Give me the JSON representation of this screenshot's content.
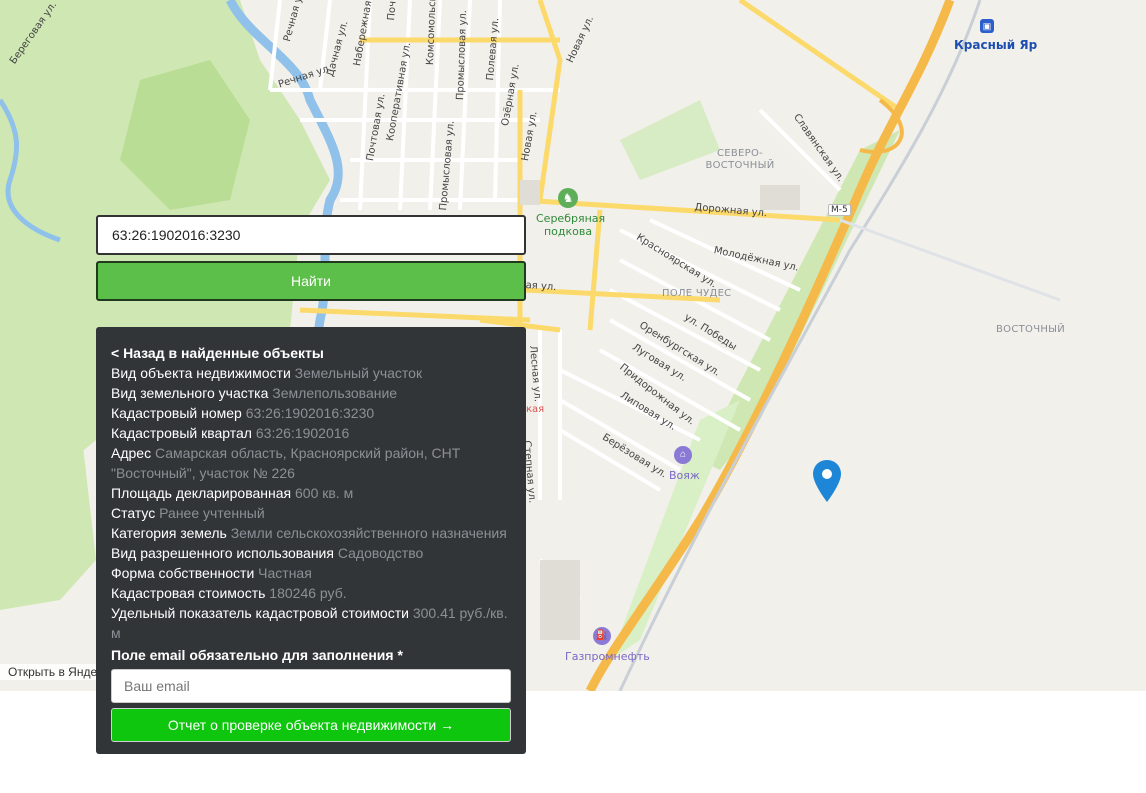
{
  "map": {
    "open_in_yandex": "Открыть в Янде",
    "street_labels": [
      "Береговая ул.",
      "Речная ул.",
      "Речная ул.",
      "Дачная ул.",
      "Набережная ул.",
      "Почтовая ул.",
      "Кооперативная ул.",
      "Комсомольская",
      "Промысловая ул.",
      "Промысловая ул.",
      "Полевая ул.",
      "Озёрная ул.",
      "Новая ул.",
      "Новая ул.",
      "Славянская ул.",
      "Дорожная ул.",
      "Красноярская ул.",
      "Молодёжная ул.",
      "ул. Победы",
      "Оренбургская ул.",
      "Луговая ул.",
      "Придорожная ул.",
      "Липовая ул.",
      "Берёзовая ул.",
      "Лесная ул.",
      "Степная ул.",
      "ая ул.",
      "кая",
      "Поч"
    ],
    "area_labels": [
      "СЕВЕРО-ВОСТОЧНЫЙ",
      "ПОЛЕ ЧУДЕС",
      "ВОСТОЧНЫЙ"
    ],
    "poi_labels": [
      "Серебряная подкова",
      "Вояж",
      "Газпромнефть"
    ],
    "city_label": "Красный Яр",
    "road_badge": "М-5",
    "icons": [
      "horse-icon",
      "hotel-icon",
      "fuel-icon",
      "rail-station-icon",
      "map-pin-icon"
    ]
  },
  "search": {
    "value": "63:26:1902016:3230",
    "button_label": "Найти"
  },
  "details": {
    "back_label": "< Назад в найденные объекты",
    "rows": [
      {
        "label": "Вид объекта недвижимости",
        "value": "Земельный участок"
      },
      {
        "label": "Вид земельного участка",
        "value": "Землепользование"
      },
      {
        "label": "Кадастровый номер",
        "value": "63:26:1902016:3230"
      },
      {
        "label": "Кадастровый квартал",
        "value": "63:26:1902016"
      },
      {
        "label": "Адрес",
        "value": "Самарская область, Красноярский район, СНТ \"Восточный\", участок № 226"
      },
      {
        "label": "Площадь декларированная",
        "value": "600 кв. м"
      },
      {
        "label": "Статус",
        "value": "Ранее учтенный"
      },
      {
        "label": "Категория земель",
        "value": "Земли сельскохозяйственного назначения"
      },
      {
        "label": "Вид разрешенного использования",
        "value": "Садоводство"
      },
      {
        "label": "Форма собственности",
        "value": "Частная"
      },
      {
        "label": "Кадастровая стоимость",
        "value": "180246 руб."
      },
      {
        "label": "Удельный показатель кадастровой стоимости",
        "value": "300.41 руб./кв. м"
      }
    ],
    "email_note": "Поле email обязательно для заполнения *",
    "email_placeholder": "Ваш email",
    "report_button": "Отчет о проверке объекта недвижимости →"
  }
}
